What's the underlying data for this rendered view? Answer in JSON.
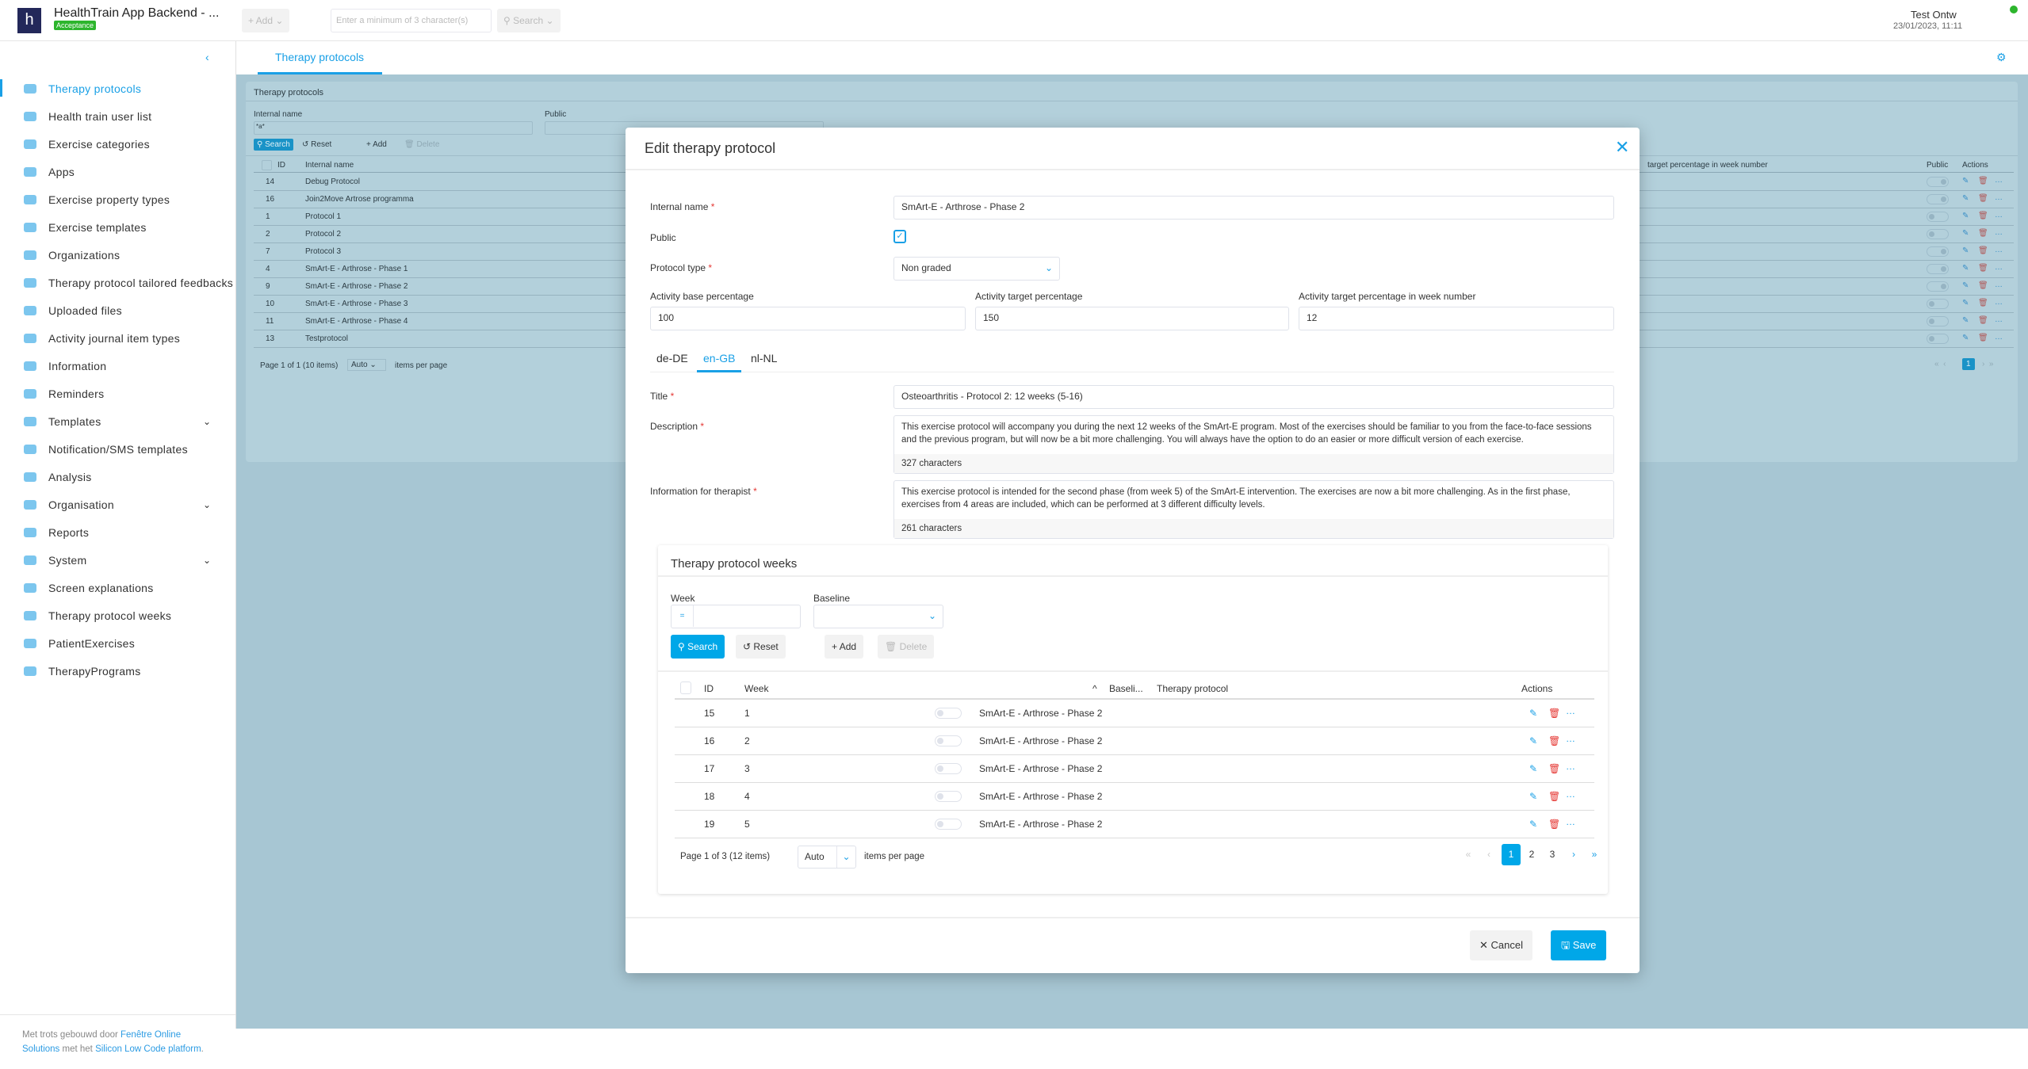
{
  "header": {
    "app_title": "HealthTrain App Backend - ...",
    "env_badge": "Acceptance",
    "logo_letter": "h",
    "add_label": "+ Add ⌄",
    "search_placeholder": "Enter a minimum of 3 character(s)",
    "search_label": "⚲ Search ⌄",
    "user_name": "Test Ontw",
    "datetime": "23/01/2023, 11:11",
    "status_color": "#2db52d"
  },
  "sidebar": {
    "collapse": "‹",
    "items": [
      {
        "label": "Therapy protocols"
      },
      {
        "label": "Health train user list"
      },
      {
        "label": "Exercise categories"
      },
      {
        "label": "Apps"
      },
      {
        "label": "Exercise property types"
      },
      {
        "label": "Exercise templates"
      },
      {
        "label": "Organizations"
      },
      {
        "label": "Therapy protocol tailored feedbacks"
      },
      {
        "label": "Uploaded files"
      },
      {
        "label": "Activity journal item types"
      },
      {
        "label": "Information"
      },
      {
        "label": "Reminders"
      },
      {
        "label": "Templates",
        "chevron": "⌄"
      },
      {
        "label": "Notification/SMS templates"
      },
      {
        "label": "Analysis"
      },
      {
        "label": "Organisation",
        "chevron": "⌄"
      },
      {
        "label": "Reports"
      },
      {
        "label": "System",
        "chevron": "⌄"
      },
      {
        "label": "Screen explanations"
      },
      {
        "label": "Therapy protocol weeks"
      },
      {
        "label": "PatientExercises"
      },
      {
        "label": "TherapyPrograms"
      }
    ],
    "footer_text1": "Met trots gebouwd door ",
    "footer_link1": "Fenêtre Online Solutions",
    "footer_text2": " met het ",
    "footer_link2": "Silicon Low Code platform",
    "footer_text3": "."
  },
  "tabs": {
    "active": "Therapy protocols"
  },
  "background_list": {
    "title": "Therapy protocols",
    "filter_internal_name_label": "Internal name",
    "filter_internal_name_op": "*a*",
    "filter_public_label": "Public",
    "search": "Search",
    "reset": "Reset",
    "add": "Add",
    "delete": "Delete",
    "columns": {
      "id": "ID",
      "internal_name": "Internal name",
      "week_number": "target percentage in week number",
      "public": "Public",
      "actions": "Actions"
    },
    "rows": [
      {
        "id": "14",
        "name": "Debug Protocol",
        "public": true
      },
      {
        "id": "16",
        "name": "Join2Move Artrose programma",
        "public": true
      },
      {
        "id": "1",
        "name": "Protocol 1",
        "public": false
      },
      {
        "id": "2",
        "name": "Protocol 2",
        "public": false
      },
      {
        "id": "7",
        "name": "Protocol 3",
        "public": true
      },
      {
        "id": "4",
        "name": "SmArt-E - Arthrose - Phase 1",
        "public": true
      },
      {
        "id": "9",
        "name": "SmArt-E - Arthrose - Phase 2",
        "public": true
      },
      {
        "id": "10",
        "name": "SmArt-E - Arthrose - Phase 3",
        "public": false
      },
      {
        "id": "11",
        "name": "SmArt-E - Arthrose - Phase 4",
        "public": false
      },
      {
        "id": "13",
        "name": "Testprotocol",
        "public": false
      }
    ],
    "paging": "Page 1 of 1 (10 items)",
    "page_size": "Auto",
    "items_per_page": "items per page",
    "current_page": "1"
  },
  "modal": {
    "title": "Edit therapy protocol",
    "close": "✕",
    "internal_name_label": "Internal name",
    "internal_name": "SmArt-E - Arthrose - Phase 2",
    "public_label": "Public",
    "public_checked": true,
    "protocol_type_label": "Protocol type",
    "protocol_type": "Non graded",
    "base_pct_label": "Activity base percentage",
    "base_pct": "100",
    "target_pct_label": "Activity target percentage",
    "target_pct": "150",
    "target_week_label": "Activity target percentage in week number",
    "target_week": "12",
    "lang_tabs": [
      "de-DE",
      "en-GB",
      "nl-NL"
    ],
    "active_lang": "en-GB",
    "title_label": "Title",
    "title_value": "Osteoarthritis - Protocol 2: 12 weeks (5-16)",
    "description_label": "Description",
    "description": "This exercise protocol will accompany you during the next 12 weeks of the SmArt-E program. Most of the exercises should be familiar to you from the face-to-face sessions and the previous program, but will now be a bit more challenging. You will always have the option to do an easier or more difficult version of each exercise.",
    "description_count": "327 characters",
    "info_label": "Information for therapist",
    "info": "This exercise protocol is intended for the second phase (from week 5) of the SmArt-E intervention. The exercises are now a bit more challenging. As in the first phase, exercises from 4 areas are included, which can be performed at 3 different difficulty levels.",
    "info_count": "261 characters",
    "cancel": "Cancel",
    "save": "Save"
  },
  "weeks": {
    "title": "Therapy protocol weeks",
    "week_label": "Week",
    "week_op": "=",
    "baseline_label": "Baseline",
    "search": "Search",
    "reset": "Reset",
    "add": "Add",
    "delete": "Delete",
    "columns": {
      "id": "ID",
      "week": "Week",
      "baseline": "Baseli...",
      "protocol": "Therapy protocol",
      "actions": "Actions"
    },
    "rows": [
      {
        "id": "15",
        "week": "1",
        "protocol": "SmArt-E - Arthrose - Phase 2"
      },
      {
        "id": "16",
        "week": "2",
        "protocol": "SmArt-E - Arthrose - Phase 2"
      },
      {
        "id": "17",
        "week": "3",
        "protocol": "SmArt-E - Arthrose - Phase 2"
      },
      {
        "id": "18",
        "week": "4",
        "protocol": "SmArt-E - Arthrose - Phase 2"
      },
      {
        "id": "19",
        "week": "5",
        "protocol": "SmArt-E - Arthrose - Phase 2"
      }
    ],
    "paging": "Page 1 of 3 (12 items)",
    "page_size": "Auto",
    "items_per_page": "items per page",
    "pages": [
      "1",
      "2",
      "3"
    ]
  }
}
